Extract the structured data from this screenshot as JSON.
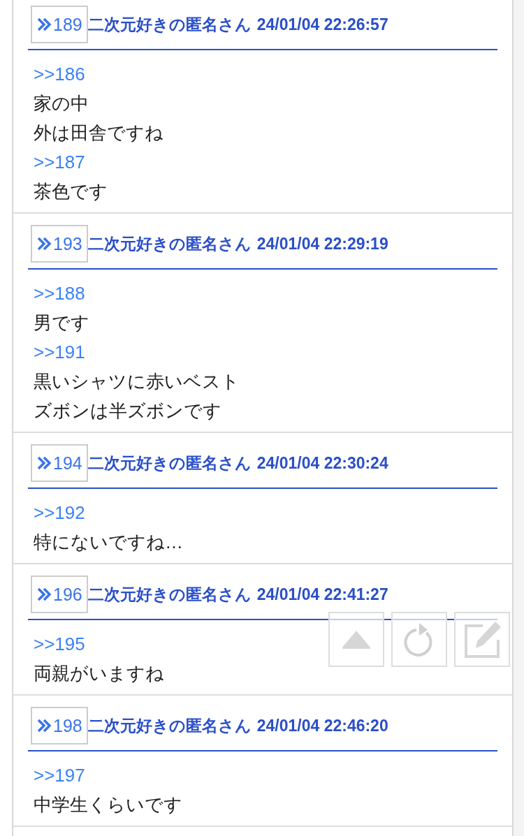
{
  "posts": [
    {
      "number": "189",
      "name": "二次元好きの匿名さん",
      "datetime": "24/01/04 22:26:57",
      "lines": [
        {
          "kind": "anchor",
          "text": ">>186"
        },
        {
          "kind": "text",
          "text": "家の中"
        },
        {
          "kind": "text",
          "text": "外は田舎ですね"
        },
        {
          "kind": "anchor",
          "text": ">>187"
        },
        {
          "kind": "text",
          "text": "茶色です"
        }
      ]
    },
    {
      "number": "193",
      "name": "二次元好きの匿名さん",
      "datetime": "24/01/04 22:29:19",
      "lines": [
        {
          "kind": "anchor",
          "text": ">>188"
        },
        {
          "kind": "text",
          "text": "男です"
        },
        {
          "kind": "anchor",
          "text": ">>191"
        },
        {
          "kind": "text",
          "text": "黒いシャツに赤いベスト"
        },
        {
          "kind": "text",
          "text": "ズボンは半ズボンです"
        }
      ]
    },
    {
      "number": "194",
      "name": "二次元好きの匿名さん",
      "datetime": "24/01/04 22:30:24",
      "lines": [
        {
          "kind": "anchor",
          "text": ">>192"
        },
        {
          "kind": "text",
          "text": "特にないですね…"
        }
      ]
    },
    {
      "number": "196",
      "name": "二次元好きの匿名さん",
      "datetime": "24/01/04 22:41:27",
      "lines": [
        {
          "kind": "anchor",
          "text": ">>195"
        },
        {
          "kind": "text",
          "text": "両親がいますね"
        }
      ]
    },
    {
      "number": "198",
      "name": "二次元好きの匿名さん",
      "datetime": "24/01/04 22:46:20",
      "lines": [
        {
          "kind": "anchor",
          "text": ">>197"
        },
        {
          "kind": "text",
          "text": "中学生くらいです"
        }
      ]
    }
  ],
  "floating_buttons": [
    {
      "kind": "top"
    },
    {
      "kind": "reload"
    },
    {
      "kind": "write"
    }
  ]
}
